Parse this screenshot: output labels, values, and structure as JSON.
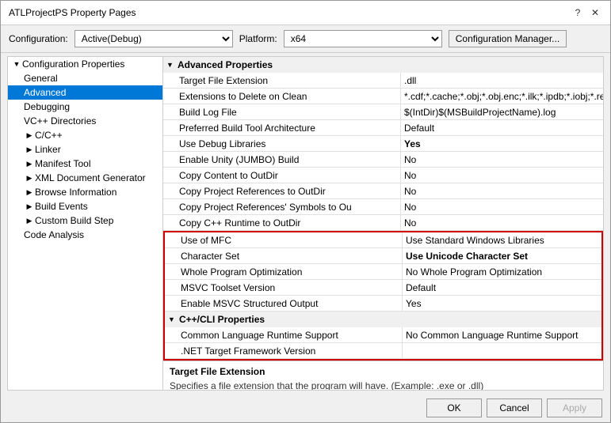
{
  "dialog": {
    "title": "ATLProjectPS Property Pages"
  },
  "title_controls": {
    "help": "?",
    "close": "✕"
  },
  "config_bar": {
    "config_label": "Configuration:",
    "config_value": "Active(Debug)",
    "platform_label": "Platform:",
    "platform_value": "x64",
    "manager_label": "Configuration Manager..."
  },
  "sidebar": {
    "items": [
      {
        "id": "config-props",
        "label": "Configuration Properties",
        "level": 0,
        "arrow": "▼",
        "selected": false
      },
      {
        "id": "general",
        "label": "General",
        "level": 1,
        "arrow": "",
        "selected": false
      },
      {
        "id": "advanced",
        "label": "Advanced",
        "level": 1,
        "arrow": "",
        "selected": true
      },
      {
        "id": "debugging",
        "label": "Debugging",
        "level": 1,
        "arrow": "",
        "selected": false
      },
      {
        "id": "vc-dirs",
        "label": "VC++ Directories",
        "level": 1,
        "arrow": "",
        "selected": false
      },
      {
        "id": "c-cpp",
        "label": "C/C++",
        "level": 1,
        "arrow": "▶",
        "selected": false
      },
      {
        "id": "linker",
        "label": "Linker",
        "level": 1,
        "arrow": "▶",
        "selected": false
      },
      {
        "id": "manifest-tool",
        "label": "Manifest Tool",
        "level": 1,
        "arrow": "▶",
        "selected": false
      },
      {
        "id": "xml-doc-gen",
        "label": "XML Document Generator",
        "level": 1,
        "arrow": "▶",
        "selected": false
      },
      {
        "id": "browse-info",
        "label": "Browse Information",
        "level": 1,
        "arrow": "▶",
        "selected": false
      },
      {
        "id": "build-events",
        "label": "Build Events",
        "level": 1,
        "arrow": "▶",
        "selected": false
      },
      {
        "id": "custom-build",
        "label": "Custom Build Step",
        "level": 1,
        "arrow": "▶",
        "selected": false
      },
      {
        "id": "code-analysis",
        "label": "Code Analysis",
        "level": 1,
        "arrow": "",
        "selected": false
      }
    ]
  },
  "content": {
    "section_advanced": "Advanced Properties",
    "properties": [
      {
        "id": "target-ext",
        "name": "Target File Extension",
        "value": ".dll",
        "bold": false,
        "highlighted": false
      },
      {
        "id": "ext-delete",
        "name": "Extensions to Delete on Clean",
        "value": "*.cdf;*.cache;*.obj;*.obj.enc;*.ilk;*.ipdb;*.iobj;*.resources;*.t",
        "bold": false,
        "highlighted": false
      },
      {
        "id": "build-log",
        "name": "Build Log File",
        "value": "$(IntDir)$(MSBuildProjectName).log",
        "bold": false,
        "highlighted": false
      },
      {
        "id": "pref-build-tool",
        "name": "Preferred Build Tool Architecture",
        "value": "Default",
        "bold": false,
        "highlighted": false
      },
      {
        "id": "use-debug-libs",
        "name": "Use Debug Libraries",
        "value": "Yes",
        "bold": true,
        "highlighted": false
      },
      {
        "id": "unity-build",
        "name": "Enable Unity (JUMBO) Build",
        "value": "No",
        "bold": false,
        "highlighted": false
      },
      {
        "id": "copy-content",
        "name": "Copy Content to OutDir",
        "value": "No",
        "bold": false,
        "highlighted": false
      },
      {
        "id": "copy-proj-refs",
        "name": "Copy Project References to OutDir",
        "value": "No",
        "bold": false,
        "highlighted": false
      },
      {
        "id": "copy-proj-syms",
        "name": "Copy Project References' Symbols to Ou",
        "value": "No",
        "bold": false,
        "highlighted": false
      },
      {
        "id": "copy-cpp-rt",
        "name": "Copy C++ Runtime to OutDir",
        "value": "No",
        "bold": false,
        "highlighted": false
      }
    ],
    "highlighted_properties": [
      {
        "id": "use-mfc",
        "name": "Use of MFC",
        "value": "Use Standard Windows Libraries",
        "bold": false
      },
      {
        "id": "char-set",
        "name": "Character Set",
        "value": "Use Unicode Character Set",
        "bold": true
      },
      {
        "id": "whole-prog-opt",
        "name": "Whole Program Optimization",
        "value": "No Whole Program Optimization",
        "bold": false
      },
      {
        "id": "msvc-toolset",
        "name": "MSVC Toolset Version",
        "value": "Default",
        "bold": false
      },
      {
        "id": "msvc-struct-out",
        "name": "Enable MSVC Structured Output",
        "value": "Yes",
        "bold": false
      }
    ],
    "section_cli": "C++/CLI Properties",
    "cli_properties": [
      {
        "id": "clr-support",
        "name": "Common Language Runtime Support",
        "value": "No Common Language Runtime Support",
        "bold": false
      },
      {
        "id": "net-target",
        "name": ".NET Target Framework Version",
        "value": "",
        "bold": false
      }
    ],
    "info_section": {
      "title": "Target File Extension",
      "description": "Specifies a file extension that the program will have. (Example: .exe or .dll)"
    }
  },
  "footer": {
    "ok": "OK",
    "cancel": "Cancel",
    "apply": "Apply"
  }
}
